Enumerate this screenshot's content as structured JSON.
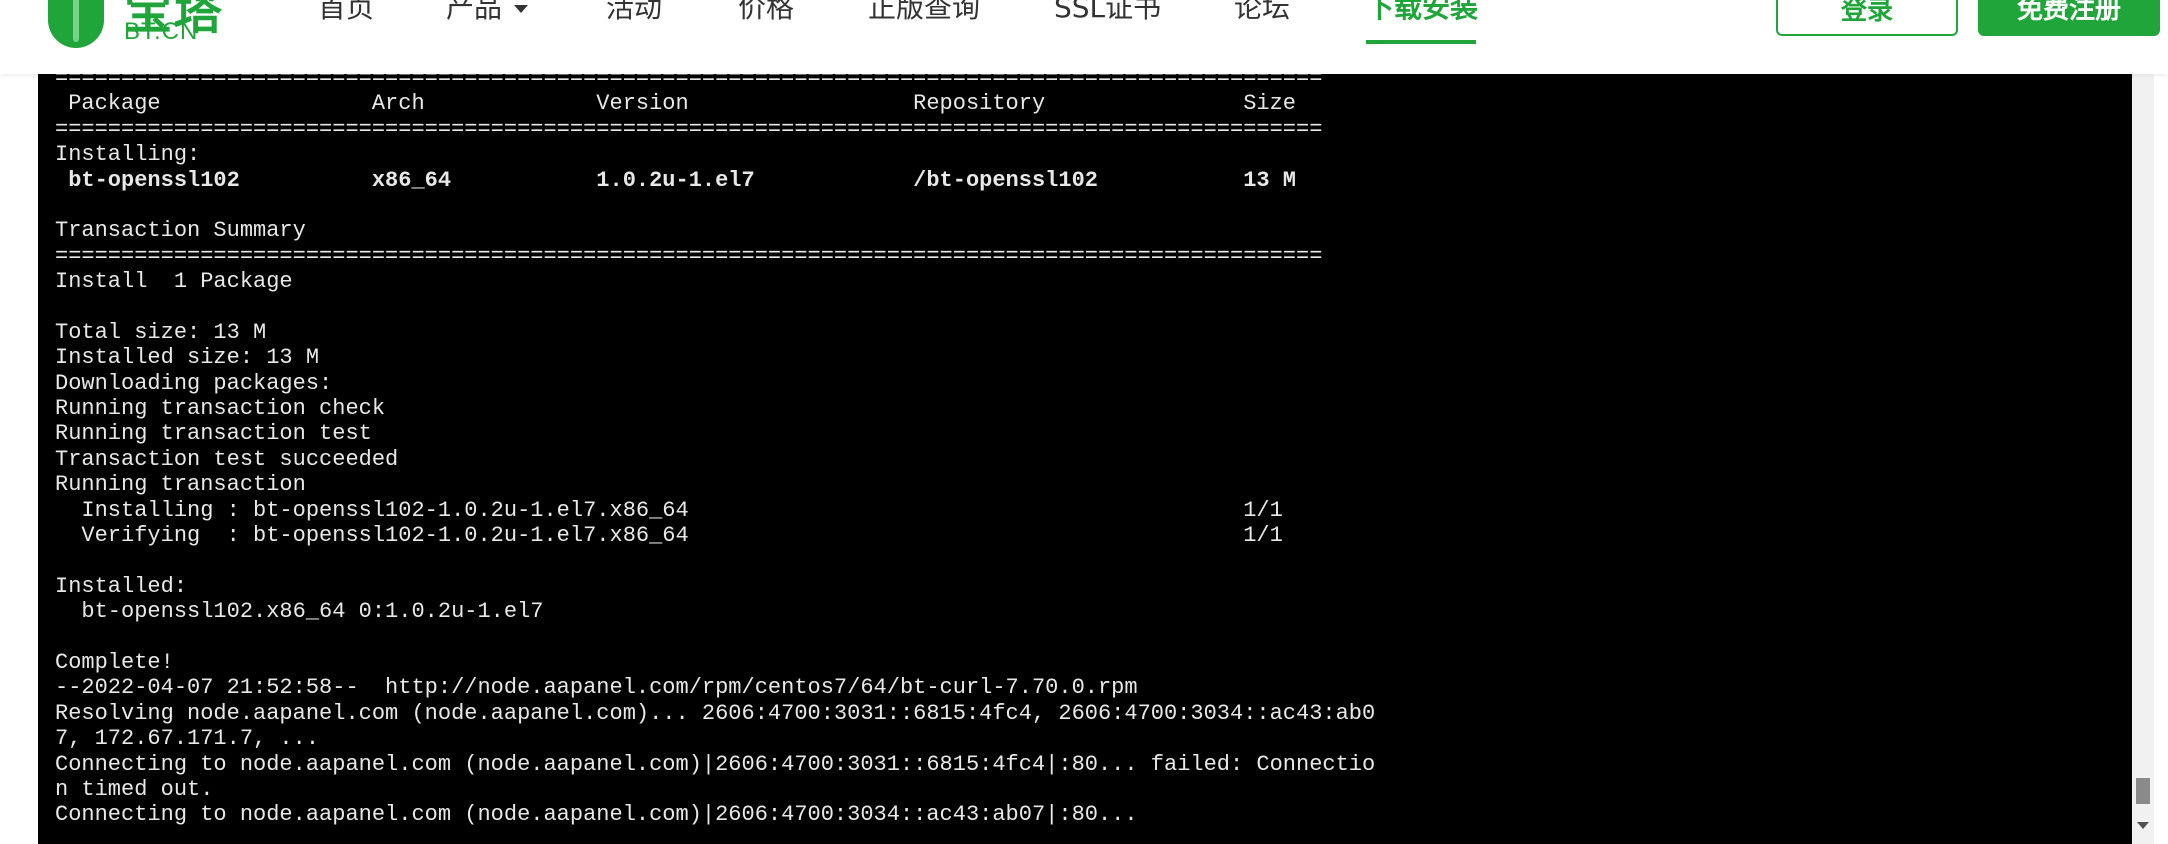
{
  "header": {
    "logo_text": "宝塔",
    "logo_sub": "BT.CN",
    "nav": [
      {
        "label": "首页"
      },
      {
        "label": "产品"
      },
      {
        "label": "活动"
      },
      {
        "label": "价格"
      },
      {
        "label": "正版查询"
      },
      {
        "label": "SSL证书"
      },
      {
        "label": "论坛"
      },
      {
        "label": "下载安装"
      }
    ],
    "active_nav": "下载安装",
    "login_label": "登录",
    "register_label": "免费注册"
  },
  "colors": {
    "brand": "#20a53a",
    "terminal_bg": "#000000",
    "terminal_fg": "#e8e8e8"
  },
  "terminal": {
    "lines": [
      "================================================================================================",
      " Package                Arch             Version                 Repository               Size",
      "================================================================================================",
      "Installing:",
      " bt-openssl102          x86_64           1.0.2u-1.el7            /bt-openssl102           13 M",
      "",
      "Transaction Summary",
      "================================================================================================",
      "Install  1 Package",
      "",
      "Total size: 13 M",
      "Installed size: 13 M",
      "Downloading packages:",
      "Running transaction check",
      "Running transaction test",
      "Transaction test succeeded",
      "Running transaction",
      "  Installing : bt-openssl102-1.0.2u-1.el7.x86_64                                          1/1",
      "  Verifying  : bt-openssl102-1.0.2u-1.el7.x86_64                                          1/1",
      "",
      "Installed:",
      "  bt-openssl102.x86_64 0:1.0.2u-1.el7",
      "",
      "Complete!",
      "--2022-04-07 21:52:58--  http://node.aapanel.com/rpm/centos7/64/bt-curl-7.70.0.rpm",
      "Resolving node.aapanel.com (node.aapanel.com)... 2606:4700:3031::6815:4fc4, 2606:4700:3034::ac43:ab0",
      "7, 172.67.171.7, ...",
      "Connecting to node.aapanel.com (node.aapanel.com)|2606:4700:3031::6815:4fc4|:80... failed: Connectio",
      "n timed out.",
      "Connecting to node.aapanel.com (node.aapanel.com)|2606:4700:3034::ac43:ab07|:80..."
    ]
  }
}
